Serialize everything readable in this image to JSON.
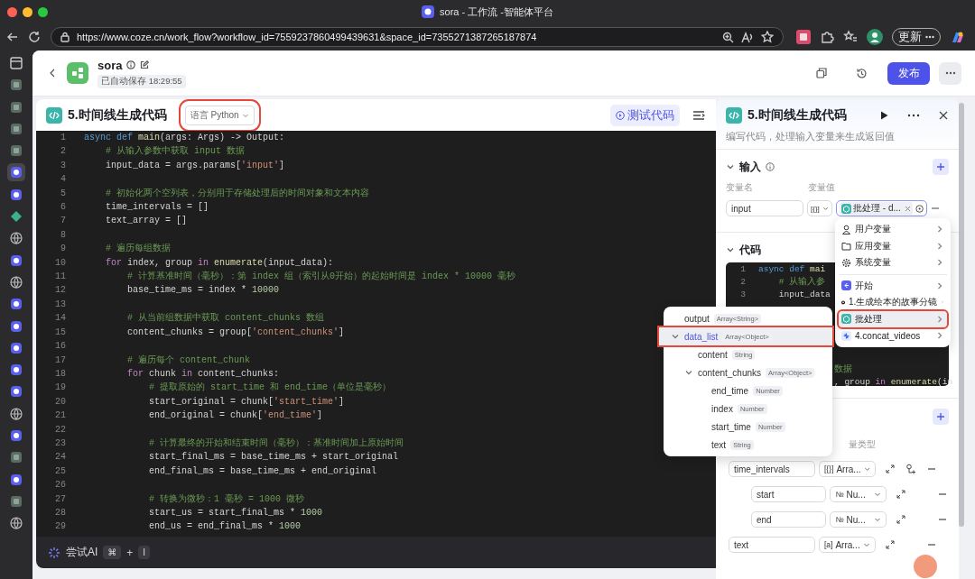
{
  "browser": {
    "tab_title": "sora - 工作流 -智能体平台",
    "url": "https://www.coze.cn/work_flow?workflow_id=7559237860499439631&space_id=7355271387265187874",
    "update_button": "更新"
  },
  "header": {
    "title": "sora",
    "autosave": "已自动保存 18:29:55",
    "publish_button": "发布"
  },
  "editor": {
    "title": "5.时间线生成代码",
    "language": {
      "label": "语言 Python",
      "highlighted": true
    },
    "test_button": "测试代码",
    "lines": [
      {
        "n": "1",
        "segs": [
          {
            "text": "async def ",
            "kind": "keyword"
          },
          {
            "text": "main",
            "kind": "function"
          },
          {
            "text": "(args: Args) -> Output:",
            "kind": "plain"
          }
        ]
      },
      {
        "n": "2",
        "segs": [
          {
            "text": "    # 从输入参数中获取 input 数据",
            "kind": "comment"
          }
        ]
      },
      {
        "n": "3",
        "segs": [
          {
            "text": "    input_data = args.params[",
            "kind": "plain"
          },
          {
            "text": "'input'",
            "kind": "string"
          },
          {
            "text": "]",
            "kind": "plain"
          }
        ]
      },
      {
        "n": "4"
      },
      {
        "n": "5",
        "segs": [
          {
            "text": "    # 初始化两个空列表，分别用于存储处理后的时间对象和文本内容",
            "kind": "comment"
          }
        ]
      },
      {
        "n": "6",
        "segs": [
          {
            "text": "    time_intervals = []",
            "kind": "plain"
          }
        ]
      },
      {
        "n": "7",
        "segs": [
          {
            "text": "    text_array = []",
            "kind": "plain"
          }
        ]
      },
      {
        "n": "8"
      },
      {
        "n": "9",
        "segs": [
          {
            "text": "    # 遍历每组数据",
            "kind": "comment"
          }
        ]
      },
      {
        "n": "10",
        "segs": [
          {
            "text": "    for",
            "kind": "control"
          },
          {
            "text": " index, group ",
            "kind": "plain"
          },
          {
            "text": "in",
            "kind": "control"
          },
          {
            "text": " enumerate",
            "kind": "function"
          },
          {
            "text": "(input_data):",
            "kind": "plain"
          }
        ]
      },
      {
        "n": "11",
        "segs": [
          {
            "text": "        # 计算基准时间（毫秒）：第 index 组（索引从0开始）的起始时间是 index * 10000 毫秒",
            "kind": "comment"
          }
        ]
      },
      {
        "n": "12",
        "segs": [
          {
            "text": "        base_time_ms = index * ",
            "kind": "plain"
          },
          {
            "text": "10000",
            "kind": "number"
          }
        ]
      },
      {
        "n": "13"
      },
      {
        "n": "14",
        "segs": [
          {
            "text": "        # 从当前组数据中获取 content_chunks 数组",
            "kind": "comment"
          }
        ]
      },
      {
        "n": "15",
        "segs": [
          {
            "text": "        content_chunks = group[",
            "kind": "plain"
          },
          {
            "text": "'content_chunks'",
            "kind": "string"
          },
          {
            "text": "]",
            "kind": "plain"
          }
        ]
      },
      {
        "n": "16"
      },
      {
        "n": "17",
        "segs": [
          {
            "text": "        # 遍历每个 content_chunk",
            "kind": "comment"
          }
        ]
      },
      {
        "n": "18",
        "segs": [
          {
            "text": "        for",
            "kind": "control"
          },
          {
            "text": " chunk ",
            "kind": "plain"
          },
          {
            "text": "in",
            "kind": "control"
          },
          {
            "text": " content_chunks:",
            "kind": "plain"
          }
        ]
      },
      {
        "n": "19",
        "segs": [
          {
            "text": "            # 提取原始的 start_time 和 end_time（单位是毫秒）",
            "kind": "comment"
          }
        ]
      },
      {
        "n": "20",
        "segs": [
          {
            "text": "            start_original = chunk[",
            "kind": "plain"
          },
          {
            "text": "'start_time'",
            "kind": "string"
          },
          {
            "text": "]",
            "kind": "plain"
          }
        ]
      },
      {
        "n": "21",
        "segs": [
          {
            "text": "            end_original = chunk[",
            "kind": "plain"
          },
          {
            "text": "'end_time'",
            "kind": "string"
          },
          {
            "text": "]",
            "kind": "plain"
          }
        ]
      },
      {
        "n": "22"
      },
      {
        "n": "23",
        "segs": [
          {
            "text": "            # 计算最终的开始和结束时间（毫秒）：基准时间加上原始时间",
            "kind": "comment"
          }
        ]
      },
      {
        "n": "24",
        "segs": [
          {
            "text": "            start_final_ms = base_time_ms + start_original",
            "kind": "plain"
          }
        ]
      },
      {
        "n": "25",
        "segs": [
          {
            "text": "            end_final_ms = base_time_ms + end_original",
            "kind": "plain"
          }
        ]
      },
      {
        "n": "26"
      },
      {
        "n": "27",
        "segs": [
          {
            "text": "            # 转换为微秒：1 毫秒 = 1000 微秒",
            "kind": "comment"
          }
        ]
      },
      {
        "n": "28",
        "segs": [
          {
            "text": "            start_us = start_final_ms * ",
            "kind": "plain"
          },
          {
            "text": "1000",
            "kind": "number"
          }
        ]
      },
      {
        "n": "29",
        "segs": [
          {
            "text": "            end_us = end_final_ms * ",
            "kind": "plain"
          },
          {
            "text": "1000",
            "kind": "number"
          }
        ]
      }
    ],
    "ai_bar": {
      "label": "尝试AI",
      "keys": [
        "⌘",
        "I"
      ],
      "joiner": "+"
    }
  },
  "side_panel": {
    "title": "5.时间线生成代码",
    "description": "编写代码，处理输入变量来生成返回值",
    "input": {
      "title": "输入",
      "expanded": true,
      "columns": [
        "变量名",
        "变量值"
      ],
      "row": {
        "name": "input",
        "type_icon": "[{}]",
        "value": "批处理 - d..."
      }
    },
    "code": {
      "title": "代码",
      "expanded": true,
      "lines": [
        {
          "n": "1",
          "segs": [
            {
              "text": "async def ",
              "kind": "keyword"
            },
            {
              "text": "mai",
              "kind": "function"
            }
          ]
        },
        {
          "n": "2",
          "segs": [
            {
              "text": "    # 从输入参",
              "kind": "comment"
            }
          ]
        },
        {
          "n": "3",
          "segs": [
            {
              "text": "    input_data",
              "kind": "plain"
            }
          ]
        }
      ],
      "fragments": [
        [
          {
            "text": "数据",
            "kind": "comment"
          }
        ],
        [
          {
            "text": ", group ",
            "kind": "plain"
          },
          {
            "text": "in",
            "kind": "control"
          },
          {
            "text": " enumerate",
            "kind": "function"
          },
          {
            "text": "(in",
            "kind": "plain"
          }
        ]
      ]
    },
    "output": {
      "column": "量类型",
      "rows": [
        {
          "name": "time_intervals",
          "type_icon": "[{}]",
          "type": "Arra...",
          "children": [
            {
              "name": "start",
              "type_icon": "№",
              "type": "Nu..."
            },
            {
              "name": "end",
              "type_icon": "№",
              "type": "Nu..."
            }
          ]
        },
        {
          "name": "text",
          "type_icon": "[a]",
          "type": "Arra..."
        }
      ]
    }
  },
  "variable_menu": {
    "groups": [
      [
        {
          "label": "用户变量",
          "kind": "user",
          "selected": false,
          "highlighted": false
        },
        {
          "label": "应用变量",
          "kind": "folder",
          "selected": false,
          "highlighted": false
        },
        {
          "label": "系统变量",
          "kind": "gear",
          "selected": false,
          "highlighted": false
        }
      ],
      [
        {
          "label": "开始",
          "kind": "start",
          "selected": false,
          "highlighted": false
        },
        {
          "label": "1.生成绘本的故事分镜",
          "kind": "llm",
          "selected": false,
          "highlighted": false
        },
        {
          "label": "批处理",
          "kind": "batch",
          "selected": true,
          "highlighted": true
        },
        {
          "label": "4.concat_videos",
          "kind": "plugin",
          "selected": false,
          "highlighted": false
        }
      ]
    ]
  },
  "variable_tree": [
    {
      "label": "output",
      "type": "Array<String>",
      "selected": false,
      "highlighted": false
    },
    {
      "label": "data_list",
      "type": "Array<Object>",
      "selected": true,
      "highlighted": true,
      "expanded": true,
      "children": [
        {
          "label": "content",
          "type": "String",
          "selected": false,
          "highlighted": false
        },
        {
          "label": "content_chunks",
          "type": "Array<Object>",
          "selected": false,
          "highlighted": false,
          "expanded": true,
          "children": [
            {
              "label": "end_time",
              "type": "Number",
              "selected": false,
              "highlighted": false
            },
            {
              "label": "index",
              "type": "Number",
              "selected": false,
              "highlighted": false
            },
            {
              "label": "start_time",
              "type": "Number",
              "selected": false,
              "highlighted": false
            },
            {
              "label": "text",
              "type": "String",
              "selected": false,
              "highlighted": false
            }
          ]
        }
      ]
    }
  ]
}
